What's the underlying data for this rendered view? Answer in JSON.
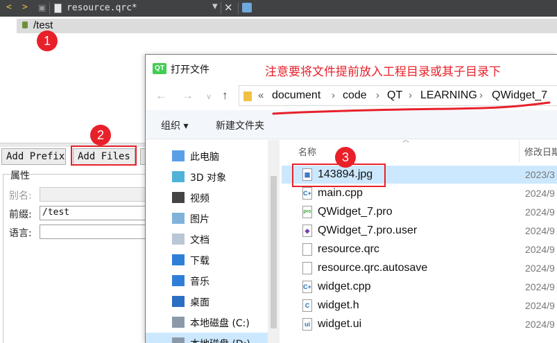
{
  "editor": {
    "tab": {
      "filename": "resource.qrc*"
    },
    "tree": {
      "prefix": "/test"
    },
    "buttons": {
      "add_prefix": "Add Prefix",
      "add_files": "Add Files"
    },
    "properties": {
      "title": "属性",
      "alias_label": "别名:",
      "alias_value": "",
      "prefix_label": "前缀:",
      "prefix_value": "/test",
      "language_label": "语言:",
      "language_value": ""
    },
    "icons": [
      "chevron-left-icon",
      "chevron-right-icon",
      "lock-icon",
      "file-icon",
      "close-icon"
    ]
  },
  "dialog": {
    "title": "打开文件",
    "logo_text": "QT",
    "breadcrumb": [
      "document",
      "code",
      "QT",
      "LEARNING",
      "QWidget_7"
    ],
    "breadcrumb_overflow": "«",
    "toolbar": {
      "organize": "组织 ▾",
      "new_folder": "新建文件夹"
    },
    "columns": {
      "name": "名称",
      "modified": "修改日期"
    },
    "nav_items": [
      {
        "label": "此电脑",
        "icon": "computer-icon",
        "selected": false
      },
      {
        "label": "3D 对象",
        "icon": "cube-icon",
        "selected": false
      },
      {
        "label": "视频",
        "icon": "film-icon",
        "selected": false
      },
      {
        "label": "图片",
        "icon": "picture-icon",
        "selected": false
      },
      {
        "label": "文档",
        "icon": "document-icon",
        "selected": false
      },
      {
        "label": "下载",
        "icon": "download-icon",
        "selected": false
      },
      {
        "label": "音乐",
        "icon": "music-icon",
        "selected": false
      },
      {
        "label": "桌面",
        "icon": "desktop-icon",
        "selected": false
      },
      {
        "label": "本地磁盘 (C:)",
        "icon": "drive-icon",
        "selected": false
      },
      {
        "label": "本地磁盘 (D:)",
        "icon": "drive-icon",
        "selected": true
      }
    ],
    "files": [
      {
        "name": "143894.jpg",
        "date": "2023/3",
        "icon": "image-file-icon",
        "selected": true
      },
      {
        "name": "main.cpp",
        "date": "2024/9",
        "icon": "cpp-file-icon",
        "selected": false
      },
      {
        "name": "QWidget_7.pro",
        "date": "2024/9",
        "icon": "pro-file-icon",
        "selected": false
      },
      {
        "name": "QWidget_7.pro.user",
        "date": "2024/9",
        "icon": "user-file-icon",
        "selected": false
      },
      {
        "name": "resource.qrc",
        "date": "2024/9",
        "icon": "file-icon",
        "selected": false
      },
      {
        "name": "resource.qrc.autosave",
        "date": "2024/9",
        "icon": "file-icon",
        "selected": false
      },
      {
        "name": "widget.cpp",
        "date": "2024/9",
        "icon": "cpp-file-icon",
        "selected": false
      },
      {
        "name": "widget.h",
        "date": "2024/9",
        "icon": "header-file-icon",
        "selected": false
      },
      {
        "name": "widget.ui",
        "date": "2024/9",
        "icon": "ui-file-icon",
        "selected": false
      }
    ]
  },
  "annotations": {
    "note": "注意要将文件提前放入工程目录或其子目录下",
    "step1": "1",
    "step2": "2",
    "step3": "3",
    "color": "#e8202a"
  }
}
